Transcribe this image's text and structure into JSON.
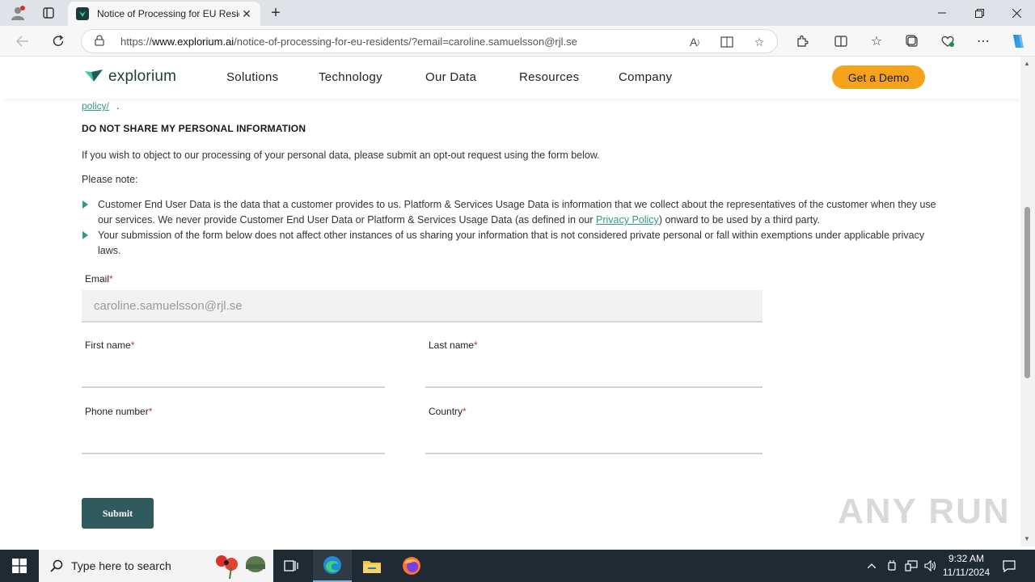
{
  "browser": {
    "tab_title": "Notice of Processing for EU Resid",
    "tab_close": "✕",
    "new_tab": "+",
    "url_prefix": "https://",
    "url_domain": "www.explorium.ai",
    "url_path": "/notice-of-processing-for-eu-residents/?email=caroline.samuelsson@rjl.se"
  },
  "site": {
    "logo_text": "explorium",
    "nav": [
      "Solutions",
      "Technology",
      "Our Data",
      "Resources",
      "Company"
    ],
    "cta": "Get a Demo"
  },
  "content": {
    "link_fragment": "policy/",
    "link_fragment_tail": ".",
    "heading": "DO NOT SHARE MY PERSONAL INFORMATION",
    "intro": "If you wish to object to our processing of your personal data, please submit an opt-out request using the form below.",
    "note": "Please note:",
    "bullet1_a": "Customer End User Data is the data that a customer provides to us. Platform & Services Usage Data is information that we collect about the representatives of the customer when they use our services. We never provide Customer End User Data or Platform & Services Usage Data (as defined in our ",
    "bullet1_link": "Privacy Policy",
    "bullet1_b": ") onward to be used by a third party.",
    "bullet2": "Your submission of the form below does not affect other instances of us sharing your information that is not considered private personal or fall within exemptions under applicable privacy laws."
  },
  "form": {
    "required_mark": "*",
    "email_label": "Email",
    "email_value": "caroline.samuelsson@rjl.se",
    "first_name_label": "First name",
    "last_name_label": "Last name",
    "phone_label": "Phone number",
    "country_label": "Country",
    "submit": "Submit"
  },
  "watermark": "ANY RUN",
  "taskbar": {
    "search_placeholder": "Type here to search",
    "time": "9:32 AM",
    "date": "11/11/2024"
  },
  "colors": {
    "accent_green": "#2f9a85",
    "cta_orange": "#f7a21b",
    "submit_teal": "#2f5a5e",
    "taskbar": "#1f2a33"
  }
}
